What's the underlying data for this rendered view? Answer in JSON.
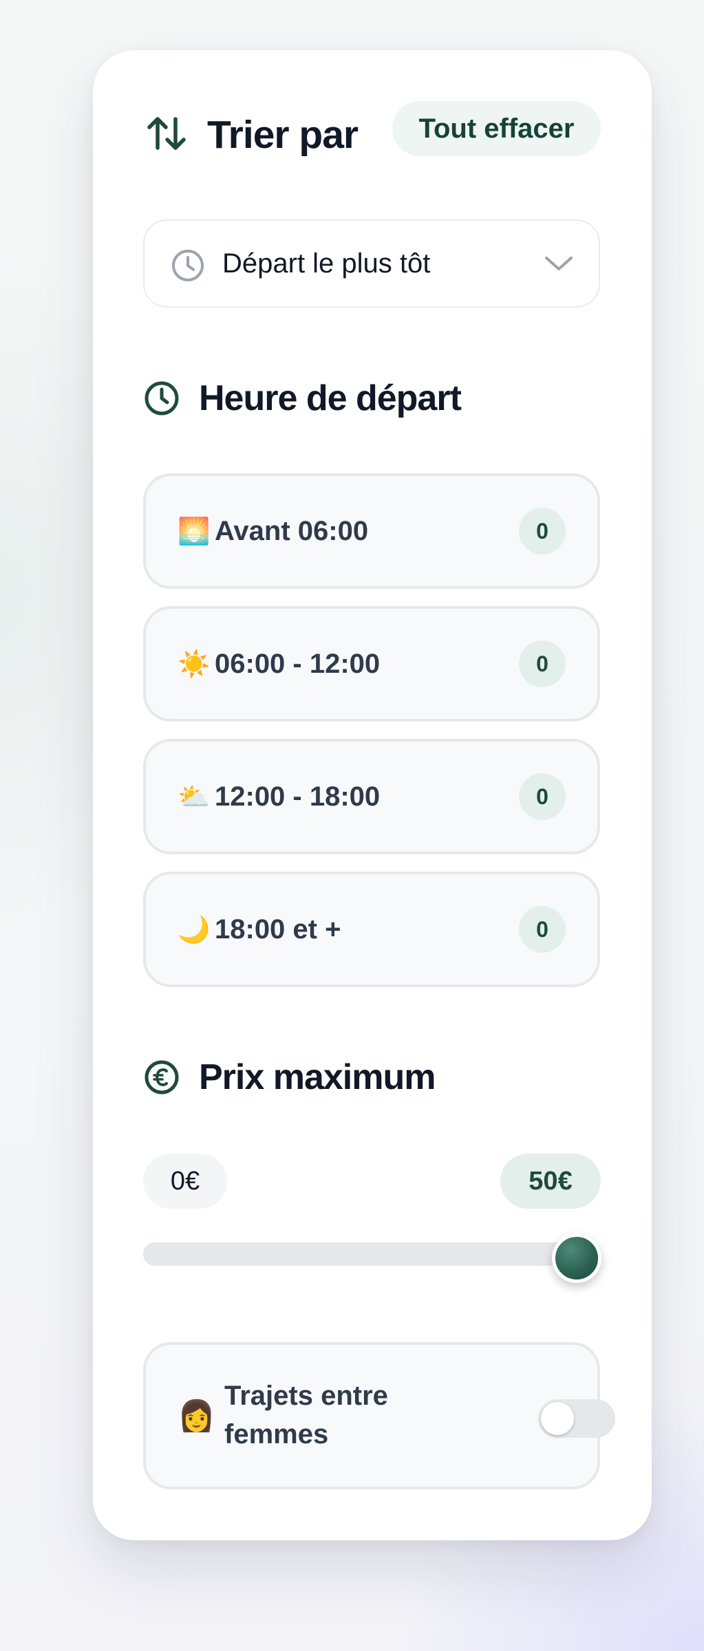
{
  "header": {
    "title": "Trier par",
    "clear_label": "Tout effacer"
  },
  "sort": {
    "selected": "Départ le plus tôt",
    "icon": "clock-icon"
  },
  "departure": {
    "title": "Heure de départ",
    "slots": [
      {
        "emoji": "🌅",
        "label": "Avant 06:00",
        "count": "0"
      },
      {
        "emoji": "☀️",
        "label": "06:00 - 12:00",
        "count": "0"
      },
      {
        "emoji": "⛅",
        "label": "12:00 - 18:00",
        "count": "0"
      },
      {
        "emoji": "🌙",
        "label": "18:00 et +",
        "count": "0"
      }
    ]
  },
  "price": {
    "title": "Prix maximum",
    "min_label": "0€",
    "max_label": "50€",
    "slider_value_fraction": 1.0
  },
  "women_only": {
    "emoji": "👩",
    "label": "Trajets entre femmes",
    "enabled": false
  },
  "colors": {
    "accent": "#1f4a3c",
    "accent_light": "#e3efea",
    "text": "#111827"
  }
}
